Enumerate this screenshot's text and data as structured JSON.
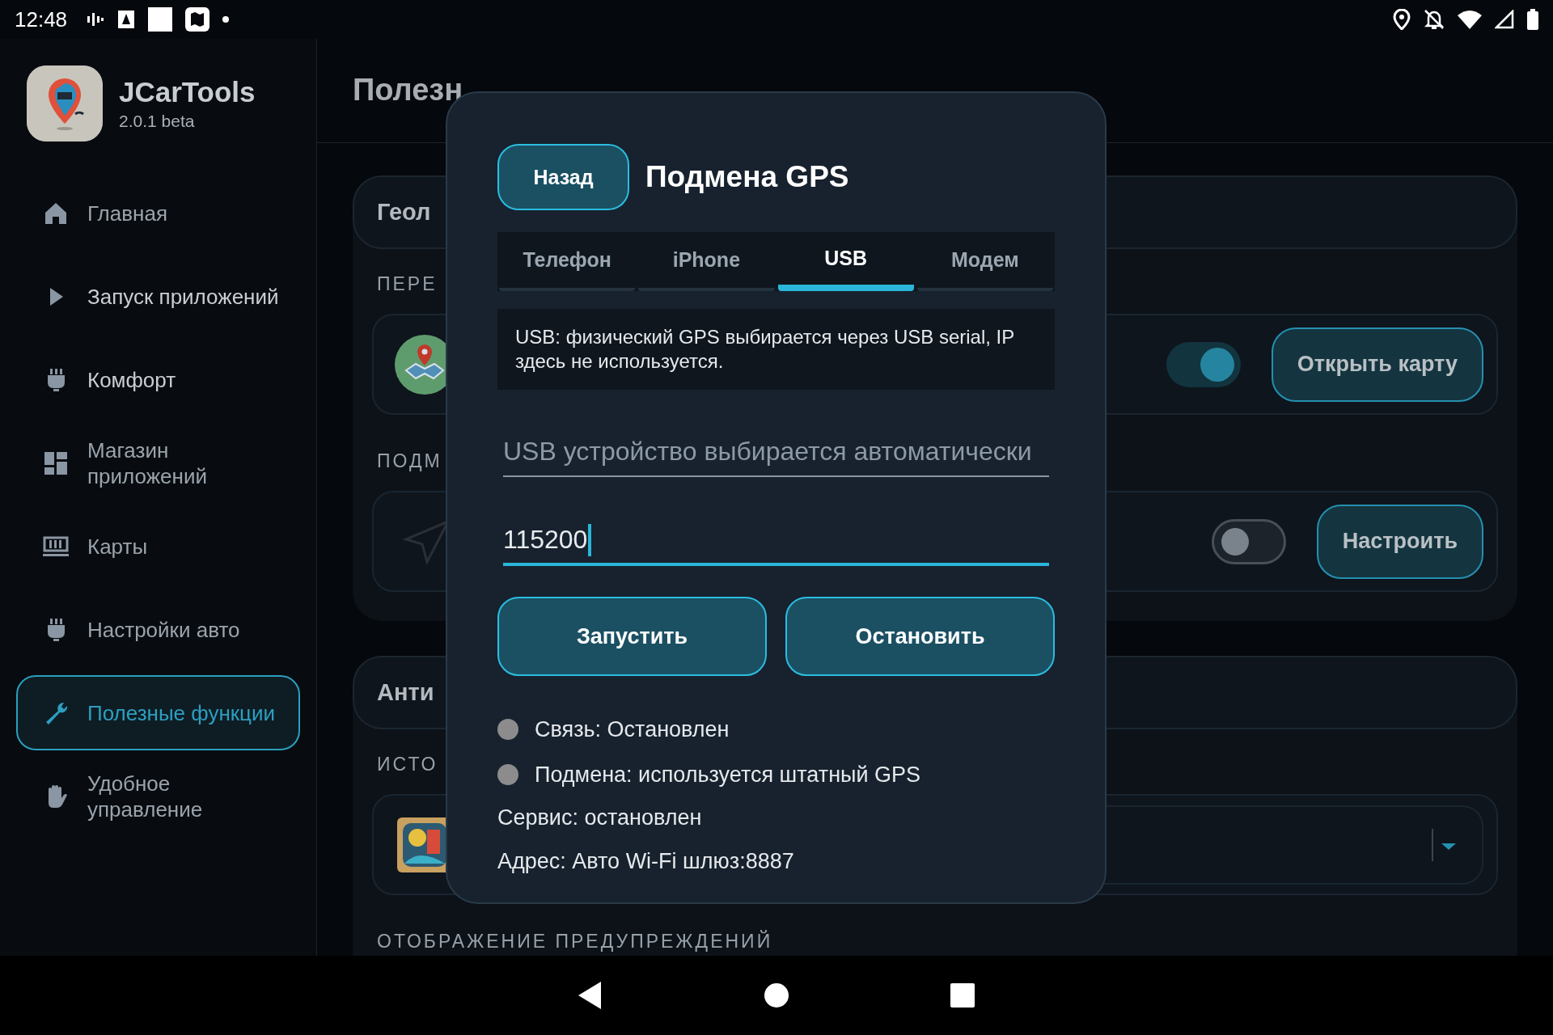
{
  "status_bar": {
    "time": "12:48"
  },
  "sidebar": {
    "app_name": "JCarTools",
    "version": "2.0.1 beta",
    "items": [
      {
        "label": "Главная",
        "selected": false
      },
      {
        "label": "Запуск приложений",
        "selected": false
      },
      {
        "label": "Комфорт",
        "selected": false
      },
      {
        "label": "Магазин приложений",
        "selected": false
      },
      {
        "label": "Карты",
        "selected": false
      },
      {
        "label": "Настройки авто",
        "selected": false
      },
      {
        "label": "Полезные функции",
        "selected": true
      },
      {
        "label": "Удобное управление",
        "selected": false
      }
    ]
  },
  "main": {
    "title": "Полезн",
    "sections": [
      {
        "title": "Геол",
        "groups": [
          {
            "label": "ПЕРЕ",
            "rows": [
              {
                "kind": "toggle",
                "on": true,
                "button": "Открыть карту"
              }
            ]
          },
          {
            "label": "ПОДМ",
            "rows": [
              {
                "kind": "toggle",
                "on": false,
                "button": "Настроить"
              }
            ]
          }
        ]
      },
      {
        "title": "Анти",
        "groups": [
          {
            "label": "ИСТО",
            "rows": [
              {
                "kind": "dropdown"
              }
            ]
          },
          {
            "label": "ОТОБРАЖЕНИЕ ПРЕДУПРЕЖДЕНИЙ"
          }
        ]
      }
    ]
  },
  "dialog": {
    "back_button": "Назад",
    "title": "Подмена GPS",
    "tabs": [
      {
        "label": "Телефон",
        "selected": false
      },
      {
        "label": "iPhone",
        "selected": false
      },
      {
        "label": "USB",
        "selected": true
      },
      {
        "label": "Модем",
        "selected": false
      }
    ],
    "info": "USB: физический GPS выбирается через USB serial, IP здесь не используется.",
    "fields": [
      {
        "placeholder": "USB устройство выбирается автоматически",
        "focused": false
      },
      {
        "value": "115200",
        "focused": true
      }
    ],
    "buttons": [
      "Запустить",
      "Остановить"
    ],
    "statuses": [
      {
        "text": "Связь: Остановлен"
      },
      {
        "text": "Подмена: используется штатный GPS"
      }
    ],
    "lines": [
      "Сервис: остановлен",
      "Адрес: Авто Wi-Fi шлюз:8887"
    ]
  }
}
